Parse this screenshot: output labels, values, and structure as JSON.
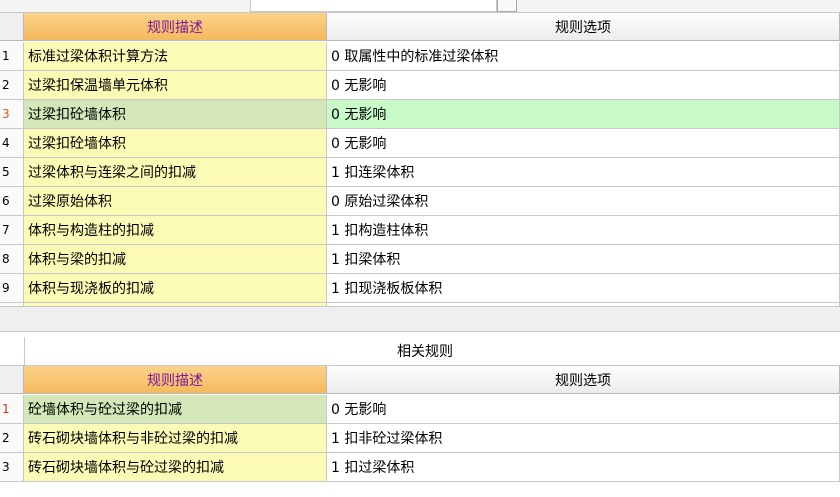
{
  "top_grid": {
    "header": {
      "desc": "规则描述",
      "options": "规则选项"
    },
    "rows": [
      {
        "idx": "1",
        "desc": "标准过梁体积计算方法",
        "option": "0 取属性中的标准过梁体积"
      },
      {
        "idx": "2",
        "desc": "过梁扣保温墙单元体积",
        "option": "0  无影响"
      },
      {
        "idx": "3",
        "desc": "过梁扣砼墙体积",
        "option": "0  无影响"
      },
      {
        "idx": "4",
        "desc": "过梁扣砼墙体积",
        "option": "0  无影响"
      },
      {
        "idx": "5",
        "desc": "过梁体积与连梁之间的扣减",
        "option": "1 扣连梁体积"
      },
      {
        "idx": "6",
        "desc": "过梁原始体积",
        "option": "0 原始过梁体积"
      },
      {
        "idx": "7",
        "desc": "体积与构造柱的扣减",
        "option": "1 扣构造柱体积"
      },
      {
        "idx": "8",
        "desc": "体积与梁的扣减",
        "option": "1 扣梁体积"
      },
      {
        "idx": "9",
        "desc": "体积与现浇板的扣减",
        "option": "1 扣现浇板板体积"
      }
    ]
  },
  "related": {
    "title": "相关规则",
    "header": {
      "desc": "规则描述",
      "options": "规则选项"
    },
    "rows": [
      {
        "idx": "1",
        "desc": "砼墙体积与砼过梁的扣减",
        "option": "0  无影响"
      },
      {
        "idx": "2",
        "desc": "砖石砌块墙体积与非砼过梁的扣减",
        "option": "1  扣非砼过梁体积"
      },
      {
        "idx": "3",
        "desc": "砖石砌块墙体积与砼过梁的扣减",
        "option": "1  扣过梁体积"
      }
    ]
  }
}
